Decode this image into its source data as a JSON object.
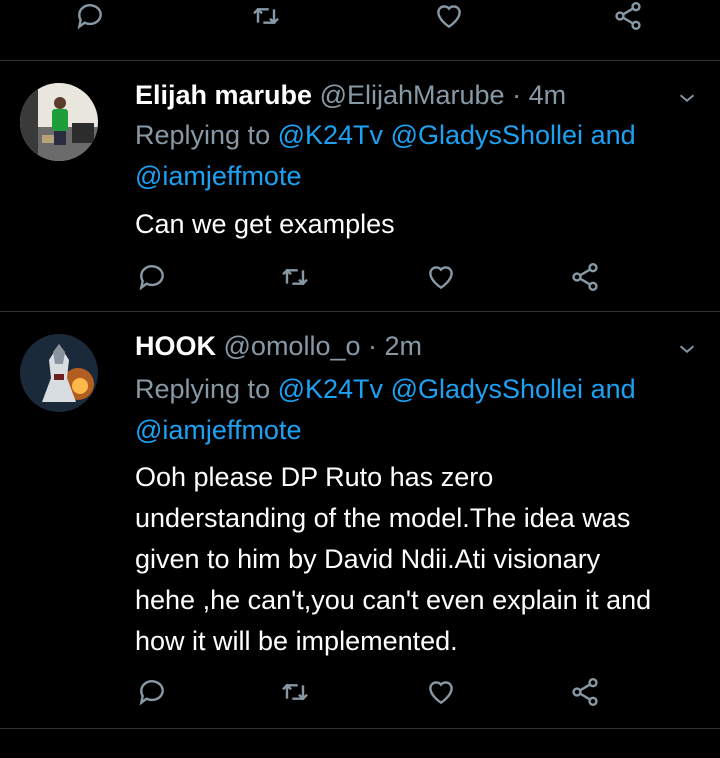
{
  "tweets": [
    {
      "name": "Elijah marube",
      "handle": "@ElijahMarube",
      "sep": " · ",
      "time": "4m",
      "replying_prefix": "Replying to ",
      "mention1": "@K24Tv",
      "mention2": "@GladysShollei",
      "and": " and",
      "mention3": "@iamjeffmote",
      "text": "Can we get examples"
    },
    {
      "name": "HOOK",
      "handle": "@omollo_o",
      "sep": " · ",
      "time": "2m",
      "replying_prefix": "Replying to ",
      "mention1": "@K24Tv",
      "mention2": "@GladysShollei",
      "and": " and",
      "mention3": "@iamjeffmote",
      "text": "Ooh please DP Ruto has zero\nunderstanding of the model.The idea was\ngiven to him by David Ndii.Ati visionary\nhehe ,he can't,you can't even explain it and\nhow it will be implemented."
    }
  ],
  "colors": {
    "background": "#000000",
    "muted": "#8899a6",
    "link": "#1da1f2",
    "divider": "#2f3336"
  },
  "icons": [
    "reply-icon",
    "retweet-icon",
    "like-icon",
    "share-icon",
    "chevron-down-icon"
  ]
}
